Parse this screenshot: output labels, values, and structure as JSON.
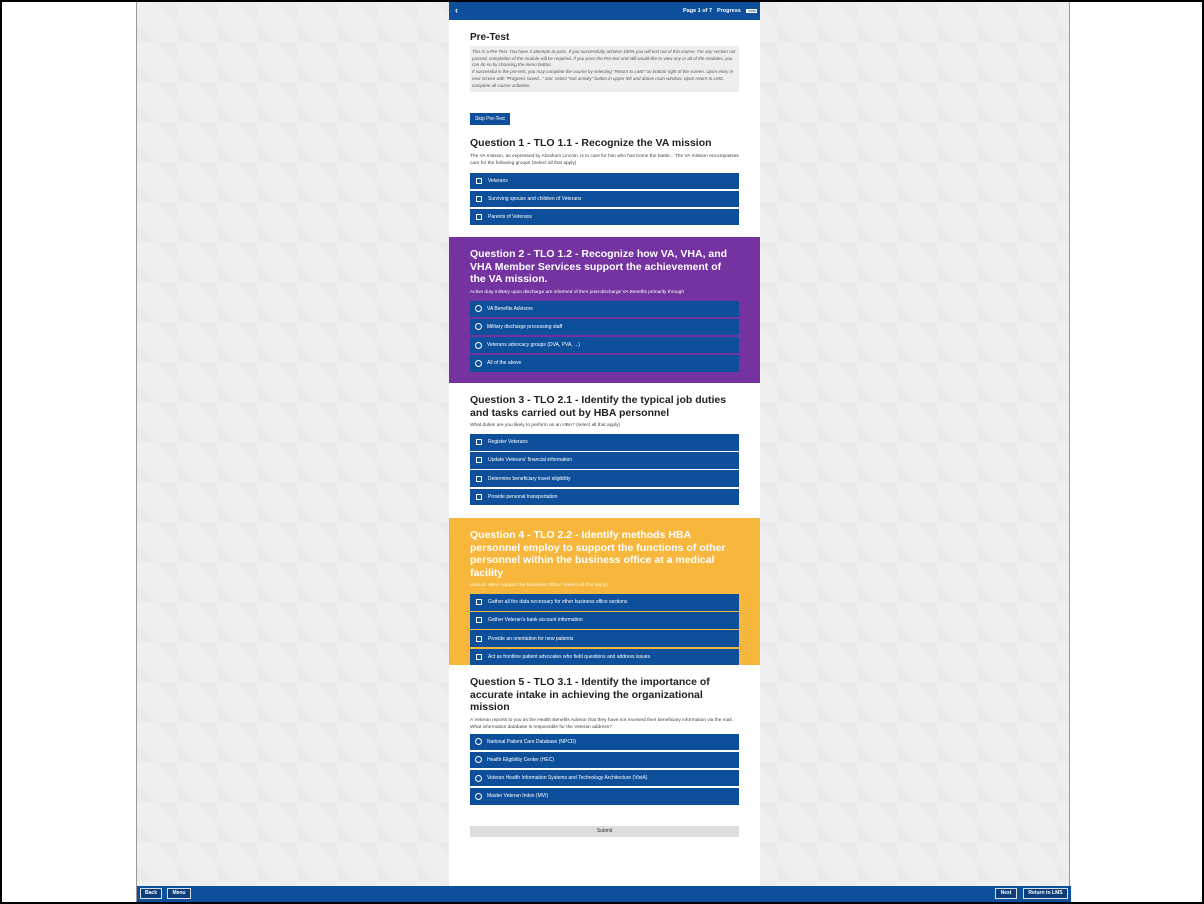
{
  "topbar": {
    "back": "‹",
    "page": "Page 1 of 7",
    "progress_label": "Progress",
    "progress_value": 0.14
  },
  "title": "Pre-Test",
  "instructions": [
    "This is a Pre-Test. You have 3 attempts to pass. If you successfully achieve 100% you will test out of this course. For any section not passed, completion of the module will be required. If you pass the Pre-test and still would like to view any or all of the modules, you can do so by choosing the menu button.",
    "If successful in the pre-test, you may complete the course by selecting \"Return to LMS\" on bottom right of the screen. Upon entry in next screen with \"Progress saved...\" text, select \"exit activity\" button in upper left and above main window. Upon return to LMS, complete all course activities."
  ],
  "skip_label": "Skip Pre-Test",
  "questions": [
    {
      "title": "Question 1 - TLO 1.1 - Recognize the VA mission",
      "prompt": "The VA mission, as expressed by Abraham Lincoln, is to care for him who has borne the battle... The VA mission encompasses care for the following groups (Select all that apply)",
      "options": [
        "Veterans",
        "Surviving spouse and children of Veterans",
        "Parents of Veterans"
      ]
    },
    {
      "title": "Question 2 - TLO 1.2 - Recognize how VA, VHA, and VHA Member Services support the achievement of the VA mission.",
      "prompt": "Active duty military upon discharge are informed of their post-discharge VA Benefits primarily  through",
      "options": [
        "VA Benefits Advisors",
        "Military discharge processing staff",
        "Veterans advocacy groups (DVA, PVA, ...)",
        "All of the above"
      ]
    },
    {
      "title": "Question 3 - TLO 2.1 - Identify the typical job duties and tasks carried out by HBA personnel",
      "prompt": "What duties are you likely to perform as an HBA? (select all that apply)",
      "options": [
        "Register Veterans",
        "Update Veterans' financial information",
        "Determine beneficiary travel eligibility",
        "Provide personal transportation"
      ]
    },
    {
      "title": "Question 4 - TLO 2.2 - Identify methods HBA personnel employ to support the functions of other personnel within the business office at a medical facility",
      "prompt": "How do HBAs support the Business Office? (select all that apply)",
      "options": [
        "Gather all the data necessary for other business office sections",
        "Gather Veteran's bank account information",
        "Provide an orientation for new patients",
        "Act as frontline patient advocates who field questions and address issues"
      ]
    },
    {
      "title": "Question 5 - TLO 3.1 - Identify the importance of accurate intake in achieving the organizational mission",
      "prompt": "A Veteran reports to you as the Health Benefits Advisor that they have not received their beneficiary information via the mail. What information database is responsible for the Veteran address?",
      "options": [
        "National Patient Care Database (NPCD)",
        "Health Eligibility Center (HEC)",
        "Veteran Health Information Systems and Technology Architecture (VistA)",
        "Master Veteran Index (MVI)"
      ]
    }
  ],
  "submit_label": "Submit",
  "bottombar": {
    "back": "Back",
    "menu": "Menu",
    "next": "Next",
    "return": "Return to LMS"
  },
  "colors": {
    "primary": "#0e4f9c",
    "purple": "#7433a0",
    "yellow": "#f6b73c"
  }
}
